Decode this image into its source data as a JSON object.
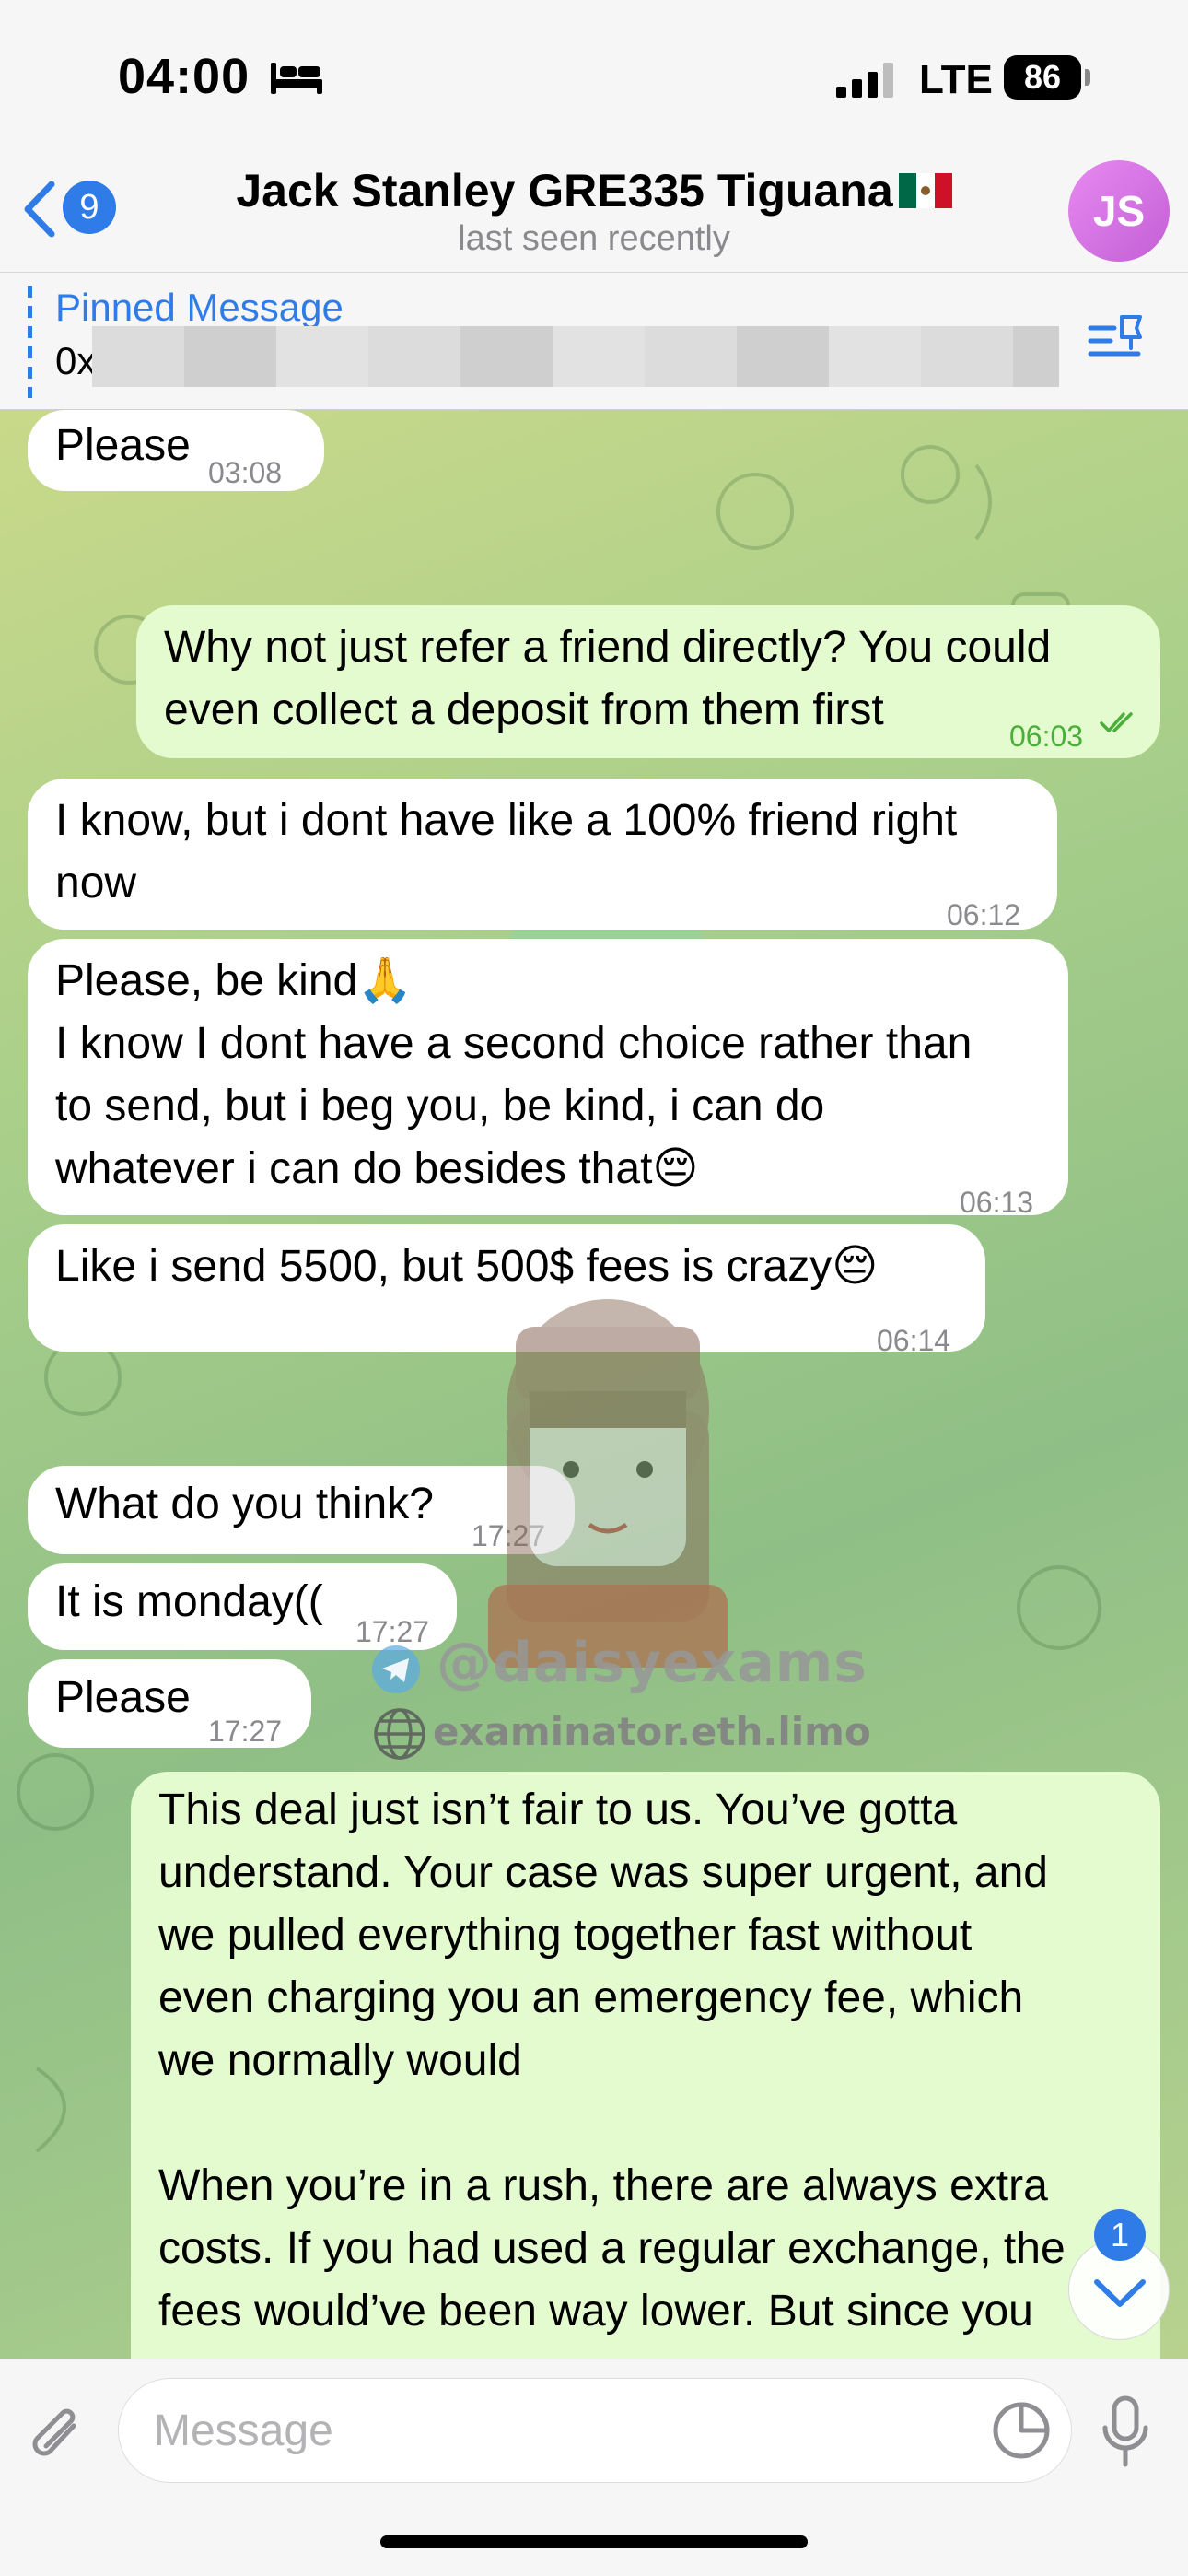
{
  "status_bar": {
    "time": "04:00",
    "network": "LTE",
    "battery": "86",
    "icons": [
      "bed-icon",
      "signal-icon",
      "battery-icon"
    ]
  },
  "header": {
    "back_badge": "9",
    "title": "Jack Stanley GRE335 Tiguana",
    "subtitle": "last seen recently",
    "avatar_initials": "JS",
    "flag": "mexico-flag-icon"
  },
  "pinned": {
    "label": "Pinned Message",
    "text_prefix": "0x"
  },
  "messages": [
    {
      "side": "in",
      "text": "Please",
      "time": "03:08"
    },
    {
      "side": "out",
      "text": "Why not just refer a friend directly? You could\neven collect a deposit from them first",
      "time": "06:03",
      "read": true
    },
    {
      "side": "in",
      "text": "I know, but i dont have like a 100% friend right\nnow",
      "time": "06:12"
    },
    {
      "side": "in",
      "text": "Please, be kind🙏\nI know I dont have a second choice rather than\nto send, but i beg you, be kind, i can do\nwhatever i can do besides that😔",
      "time": "06:13"
    },
    {
      "side": "in",
      "text": "Like i send 5500, but 500$ fees is crazy😔",
      "time": "06:14"
    },
    {
      "side": "in",
      "text": "What do you think?",
      "time": "17:27"
    },
    {
      "side": "in",
      "text": "It is monday((",
      "time": "17:27"
    },
    {
      "side": "in",
      "text": "Please",
      "time": "17:27"
    },
    {
      "side": "out",
      "text": "This deal just isn’t fair to us. You’ve gotta\nunderstand. Your case was super urgent, and\nwe pulled everything together fast without\neven charging you an emergency fee, which\nwe normally would\n\nWhen you’re in a rush, there are always extra\ncosts. If you had used a regular exchange, the\nfees would’ve been way lower. But since you",
      "time": ""
    }
  ],
  "watermark": {
    "handle": "@daisyexams",
    "site": "examinator.eth.limo"
  },
  "scroll": {
    "badge": "1"
  },
  "composer": {
    "placeholder": "Message"
  },
  "colors": {
    "accent": "#2f7ce8",
    "incoming_bubble": "#ffffff",
    "outgoing_bubble": "#e3fbcf",
    "outgoing_time": "#4aae3a"
  }
}
